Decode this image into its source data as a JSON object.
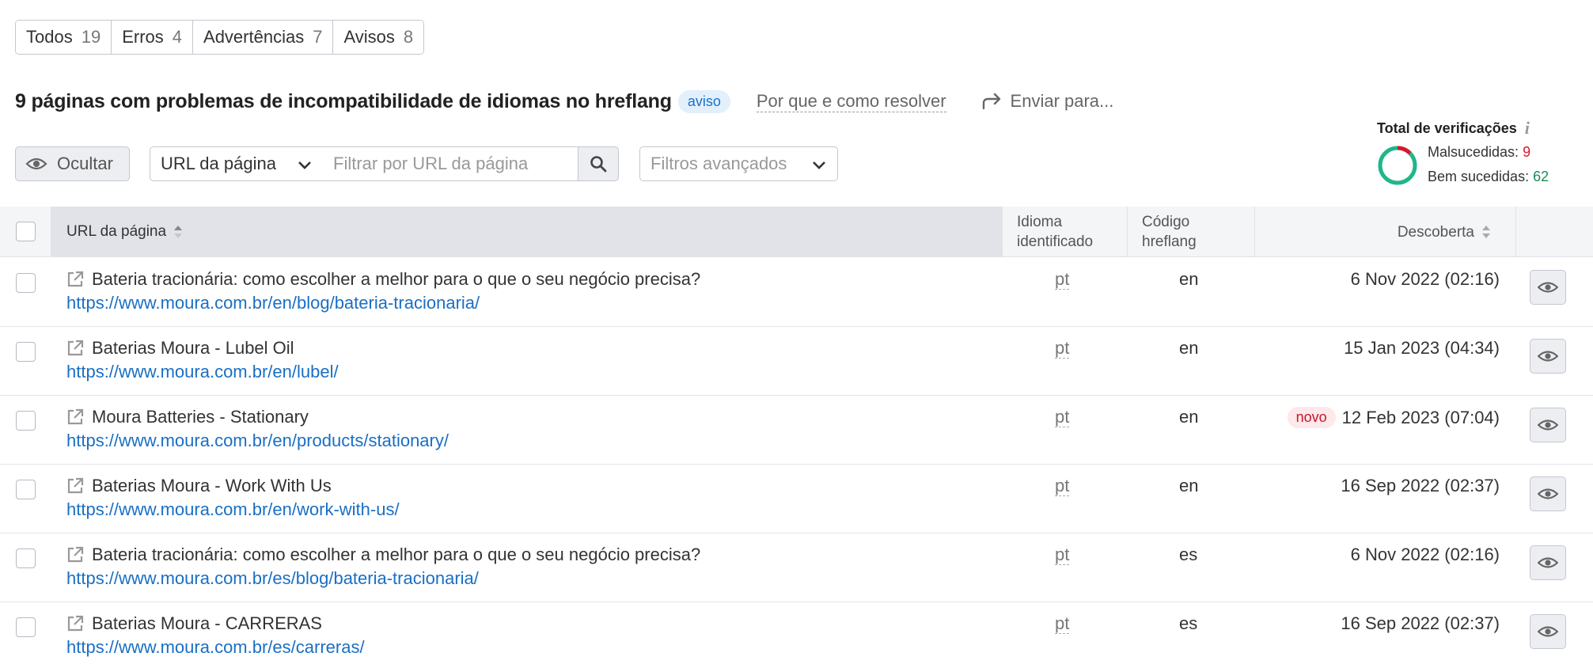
{
  "tabs": [
    {
      "label": "Todos",
      "count": "19"
    },
    {
      "label": "Erros",
      "count": "4"
    },
    {
      "label": "Advertências",
      "count": "7"
    },
    {
      "label": "Avisos",
      "count": "8"
    }
  ],
  "header": {
    "title": "9 páginas com problemas de incompatibilidade de idiomas no hreflang",
    "badge": "aviso",
    "why_link": "Por que e como resolver",
    "send_label": "Enviar para..."
  },
  "stats": {
    "title": "Total de verificações",
    "info": "i",
    "failed_label": "Malsucedidas: ",
    "failed_value": "9",
    "success_label": "Bem sucedidas: ",
    "success_value": "62",
    "colors": {
      "failed": "#d6192e",
      "success": "#1fb68a"
    }
  },
  "filters": {
    "hide_label": "Ocultar",
    "url_select": "URL da página",
    "url_placeholder": "Filtrar por URL da página",
    "advanced_label": "Filtros avançados"
  },
  "table": {
    "headers": {
      "url": "URL da página",
      "lang_line1": "Idioma",
      "lang_line2": "identificado",
      "hreflang_line1": "Código",
      "hreflang_line2": "hreflang",
      "discovered": "Descoberta"
    },
    "rows": [
      {
        "title": "Bateria tracionária: como escolher a melhor para o que o seu negócio precisa?",
        "url": "https://www.moura.com.br/en/blog/bateria-tracionaria/",
        "lang": "pt",
        "hreflang": "en",
        "badge": "",
        "date": "6 Nov 2022 (02:16)"
      },
      {
        "title": "Baterias Moura - Lubel Oil",
        "url": "https://www.moura.com.br/en/lubel/",
        "lang": "pt",
        "hreflang": "en",
        "badge": "",
        "date": "15 Jan 2023 (04:34)"
      },
      {
        "title": "Moura Batteries - Stationary",
        "url": "https://www.moura.com.br/en/products/stationary/",
        "lang": "pt",
        "hreflang": "en",
        "badge": "novo",
        "date": "12 Feb 2023 (07:04)"
      },
      {
        "title": "Baterias Moura - Work With Us",
        "url": "https://www.moura.com.br/en/work-with-us/",
        "lang": "pt",
        "hreflang": "en",
        "badge": "",
        "date": "16 Sep 2022 (02:37)"
      },
      {
        "title": "Bateria tracionária: como escolher a melhor para o que o seu negócio precisa?",
        "url": "https://www.moura.com.br/es/blog/bateria-tracionaria/",
        "lang": "pt",
        "hreflang": "es",
        "badge": "",
        "date": "6 Nov 2022 (02:16)"
      },
      {
        "title": "Baterias Moura - CARRERAS",
        "url": "https://www.moura.com.br/es/carreras/",
        "lang": "pt",
        "hreflang": "es",
        "badge": "",
        "date": "16 Sep 2022 (02:37)"
      }
    ]
  }
}
